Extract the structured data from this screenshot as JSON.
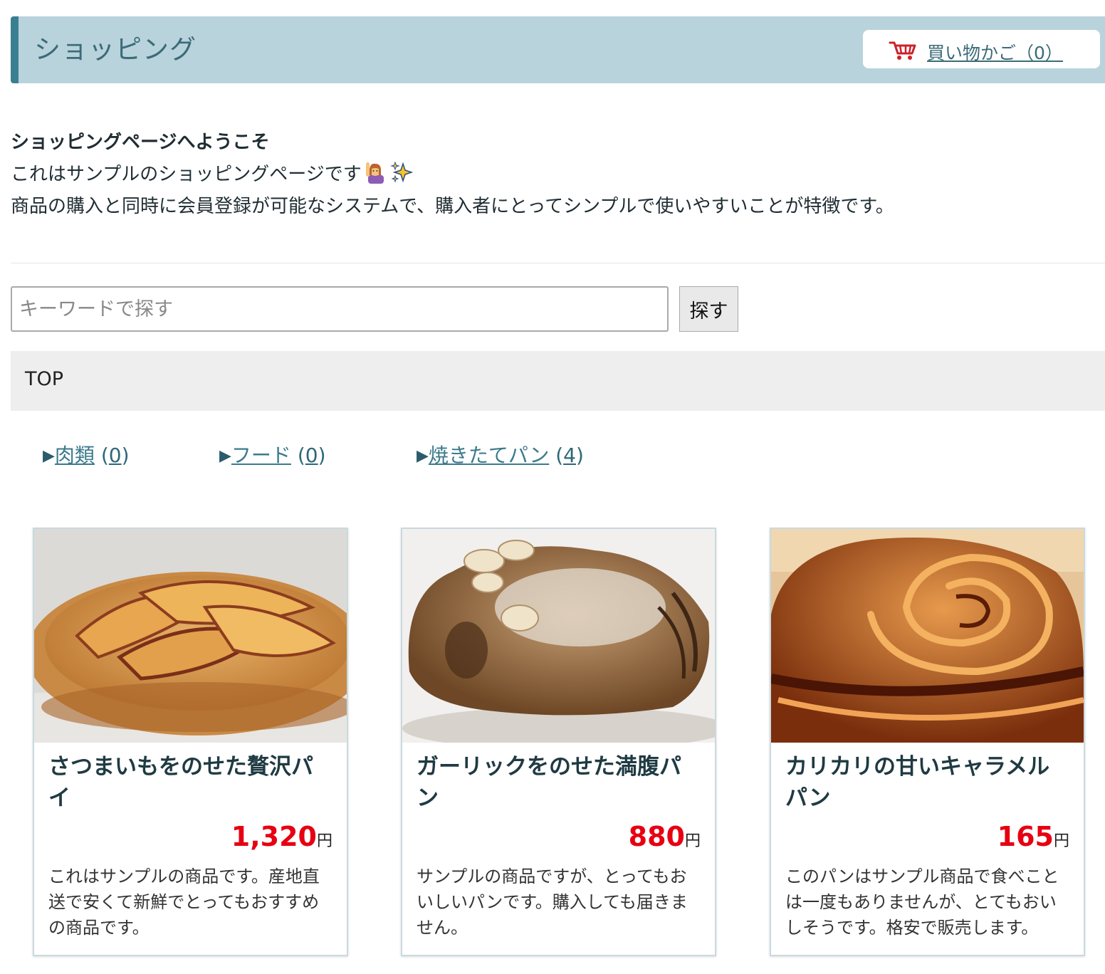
{
  "header": {
    "title": "ショッピング",
    "cart_label": "買い物かご（0）"
  },
  "welcome": {
    "title": "ショッピングページへようこそ",
    "line1": "これはサンプルのショッピングページです",
    "line2": "商品の購入と同時に会員登録が可能なシステムで、購入者にとってシンプルで使いやすいことが特徴です。"
  },
  "search": {
    "placeholder": "キーワードで探す",
    "button_label": "探す"
  },
  "breadcrumb": {
    "current": "TOP"
  },
  "categories": [
    {
      "arrow": "▶",
      "label": "肉類",
      "count": "0"
    },
    {
      "arrow": "▶",
      "label": "フード",
      "count": "0"
    },
    {
      "arrow": "▶",
      "label": "焼きたてパン",
      "count": "4"
    }
  ],
  "products": [
    {
      "name": "さつまいもをのせた贅沢パイ",
      "price": "1,320",
      "currency": "円",
      "description": "これはサンプルの商品です。産地直送で安くて新鮮でとってもおすすめの商品です。"
    },
    {
      "name": "ガーリックをのせた満腹パン",
      "price": "880",
      "currency": "円",
      "description": "サンプルの商品ですが、とってもおいしいパンです。購入しても届きません。"
    },
    {
      "name": "カリカリの甘いキャラメルパン",
      "price": "165",
      "currency": "円",
      "description": "このパンはサンプル商品で食べことは一度もありませんが、とてもおいしそうです。格安で販売します。"
    }
  ],
  "colors": {
    "header_bg": "#b9d3dc",
    "header_accent": "#3a7f91",
    "price_red": "#e60012",
    "link": "#3b7a8c"
  },
  "icons": {
    "cart": "shopping-cart-icon",
    "emoji1": "person-raising-hand-icon",
    "emoji2": "sparkles-icon"
  }
}
